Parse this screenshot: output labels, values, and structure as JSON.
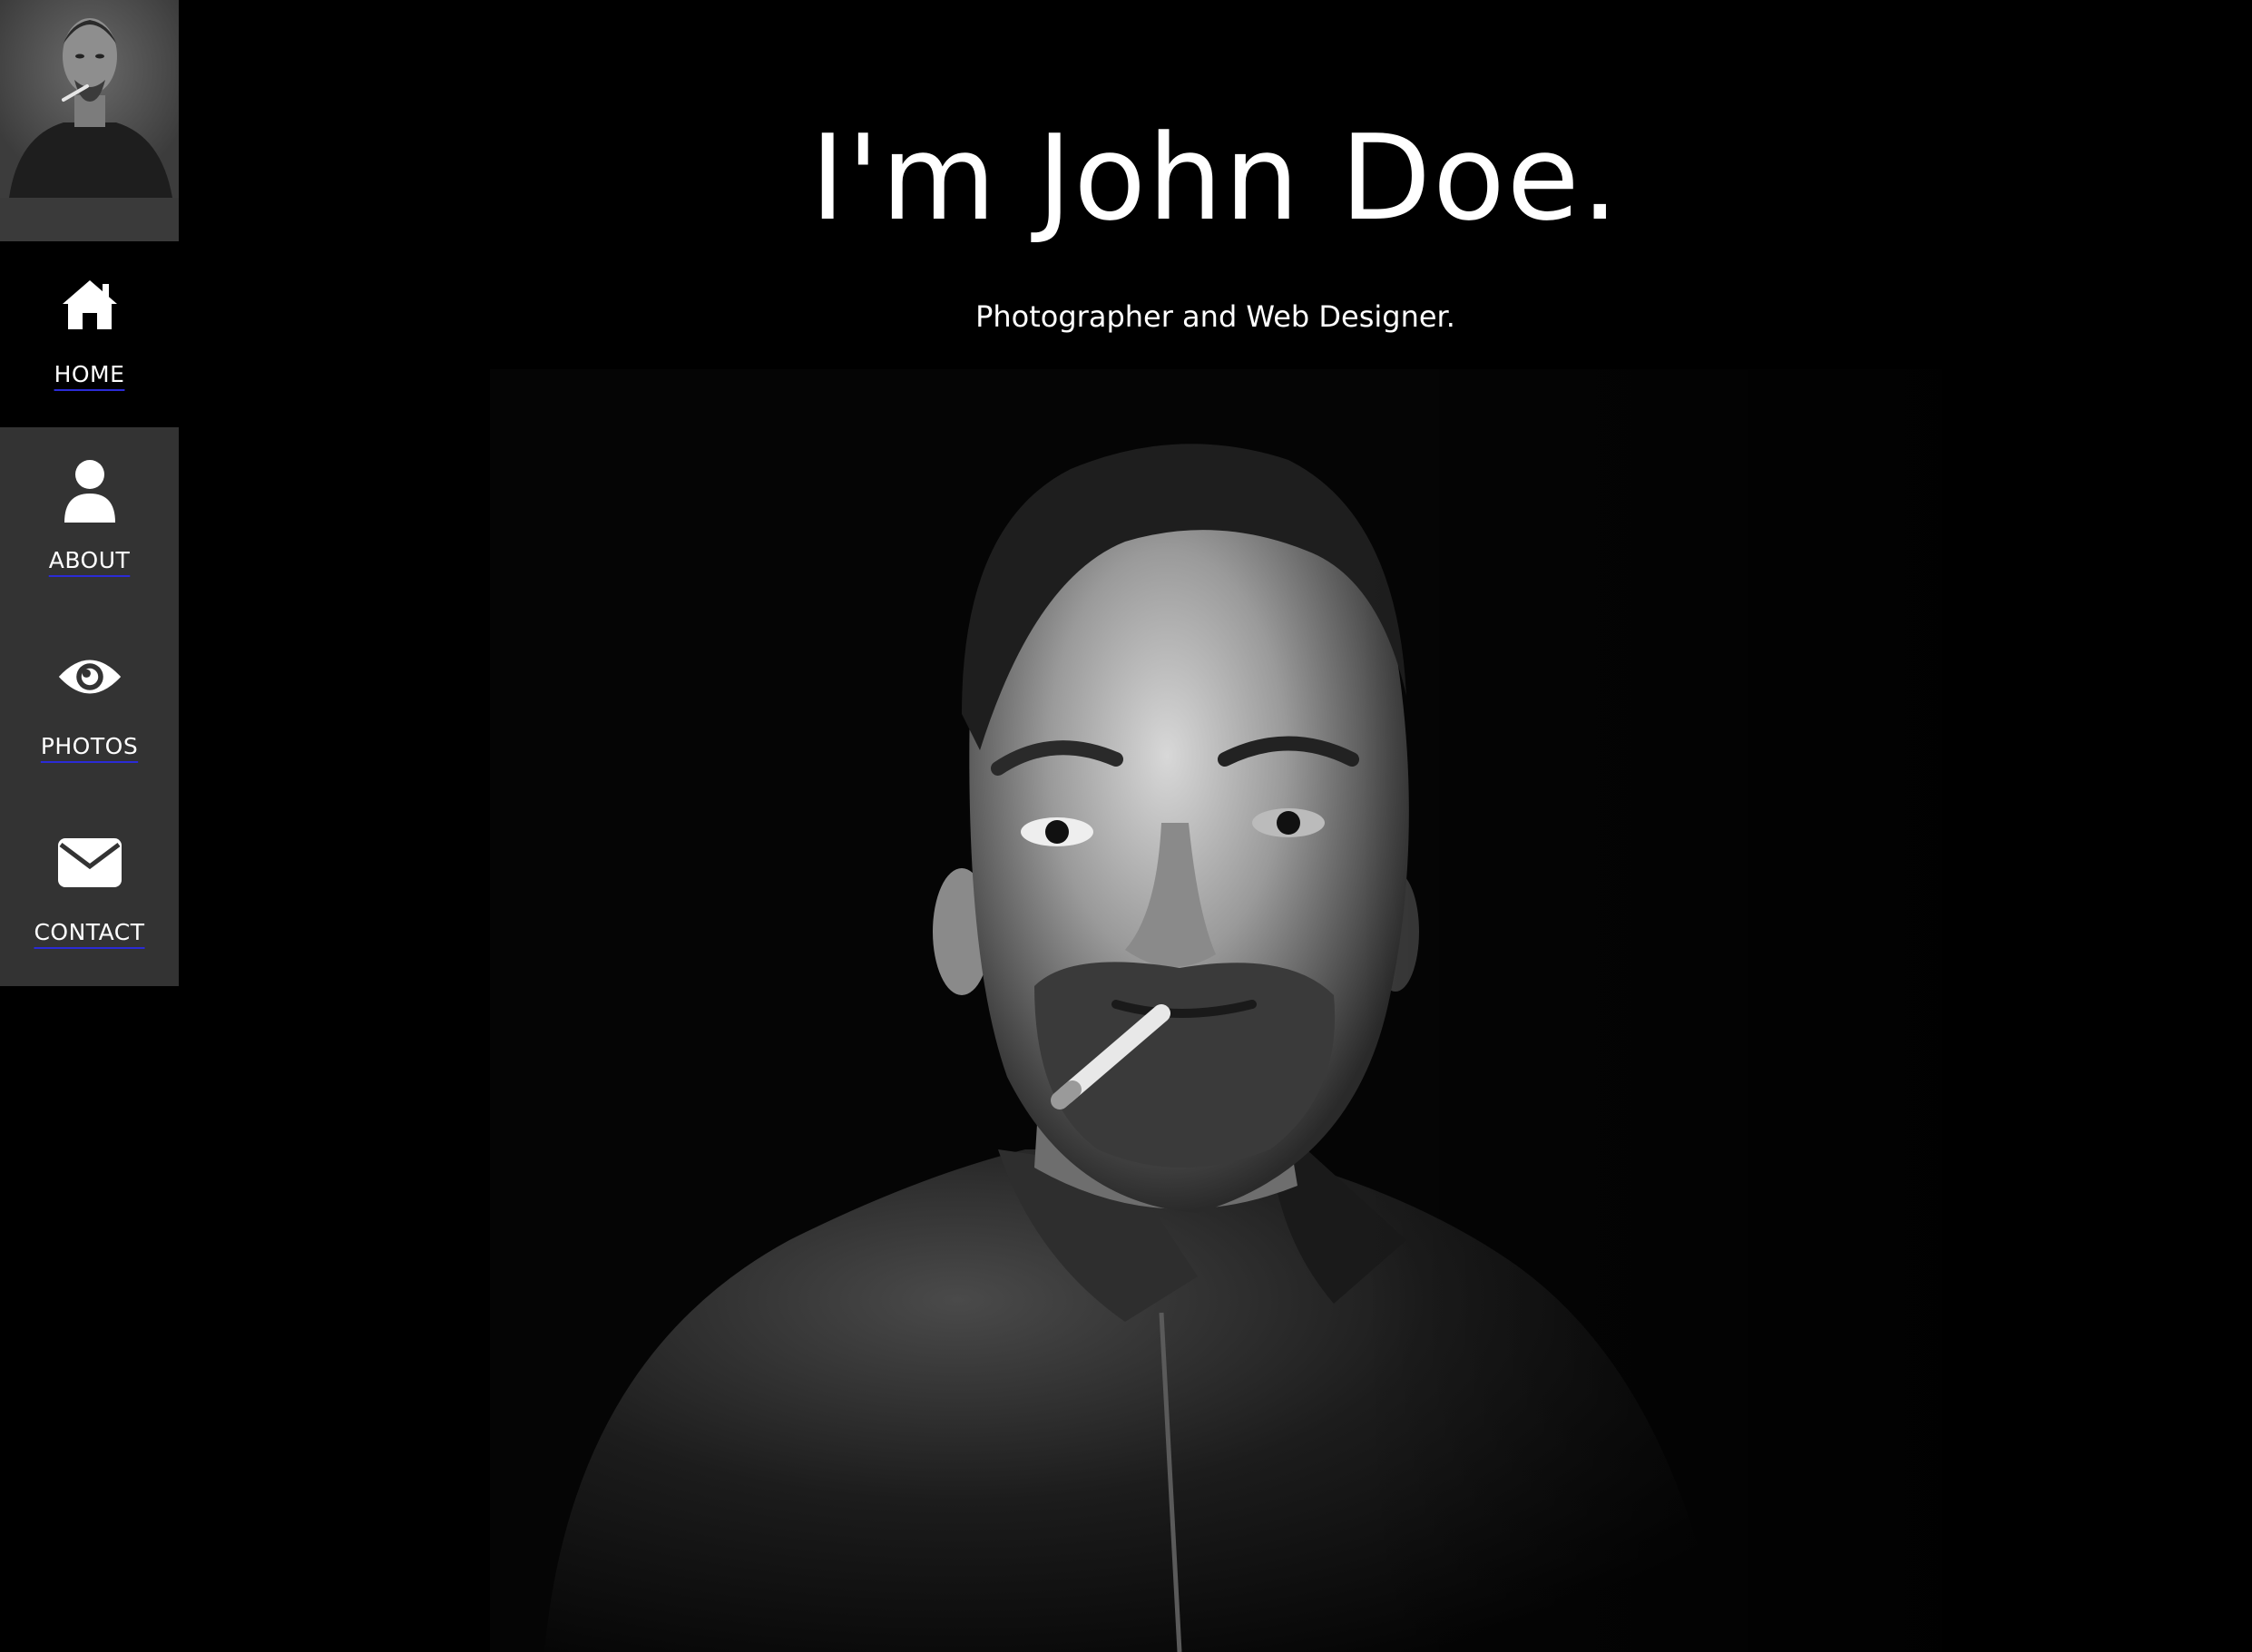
{
  "sidebar": {
    "avatar_icon": "portrait-thumbnail",
    "items": [
      {
        "label": "HOME",
        "icon": "home-icon",
        "active": true
      },
      {
        "label": "ABOUT",
        "icon": "user-icon",
        "active": false
      },
      {
        "label": "PHOTOS",
        "icon": "eye-icon",
        "active": false
      },
      {
        "label": "CONTACT",
        "icon": "envelope-icon",
        "active": false
      }
    ]
  },
  "hero": {
    "title": "I'm John Doe.",
    "subtitle": "Photographer and Web Designer."
  },
  "colors": {
    "background": "#000000",
    "sidebar": "#333333",
    "text": "#ffffff",
    "link_underline": "#2b2bd6"
  }
}
